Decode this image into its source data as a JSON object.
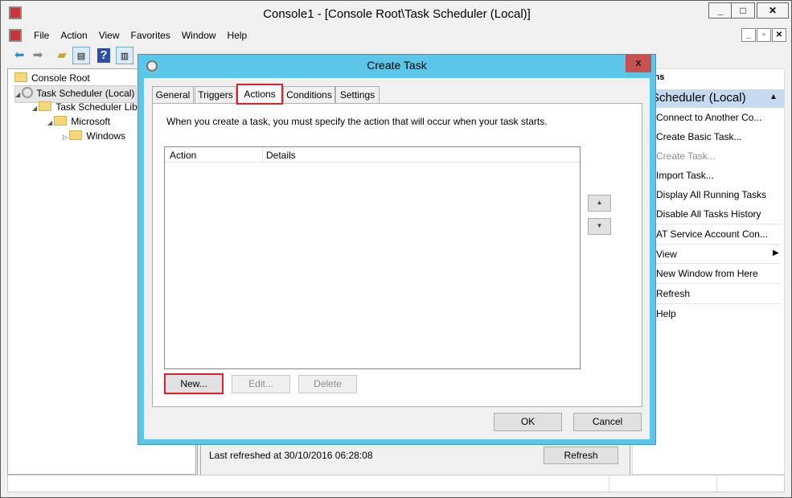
{
  "window": {
    "title": "Console1 - [Console Root\\Task Scheduler (Local)]",
    "controls": [
      "_",
      "□",
      "✕"
    ],
    "mdi_controls": [
      "_",
      "▫",
      "✕"
    ]
  },
  "menu": [
    "File",
    "Action",
    "View",
    "Favorites",
    "Window",
    "Help"
  ],
  "tree": {
    "items": [
      {
        "label": "Console Root"
      },
      {
        "label": "Task Scheduler (Local)"
      },
      {
        "label": "Task Scheduler Library"
      },
      {
        "label": "Microsoft"
      },
      {
        "label": "Windows"
      }
    ]
  },
  "middle": {
    "last_refreshed": "Last refreshed at 30/10/2016 06:28:08",
    "refresh_button": "Refresh"
  },
  "actions_pane": {
    "header": "Actions",
    "group": "Task Scheduler (Local)",
    "items": [
      "Connect to Another Co...",
      "Create Basic Task...",
      "Create Task...",
      "Import Task...",
      "Display All Running Tasks",
      "Disable All Tasks History",
      "AT Service Account Con...",
      "View",
      "New Window from Here",
      "Refresh",
      "Help"
    ]
  },
  "dialog": {
    "title": "Create Task",
    "close": "x",
    "tabs": [
      "General",
      "Triggers",
      "Actions",
      "Conditions",
      "Settings"
    ],
    "active_tab": "Actions",
    "description": "When you create a task, you must specify the action that will occur when your task starts.",
    "columns": [
      "Action",
      "Details"
    ],
    "new_button": "New...",
    "edit_button": "Edit...",
    "delete_button": "Delete",
    "ok": "OK",
    "cancel": "Cancel"
  },
  "colors": {
    "dialog_frame": "#5bc6e8",
    "highlight": "#e0202a",
    "close": "#c75050",
    "group_band": "#c5d9ef"
  }
}
